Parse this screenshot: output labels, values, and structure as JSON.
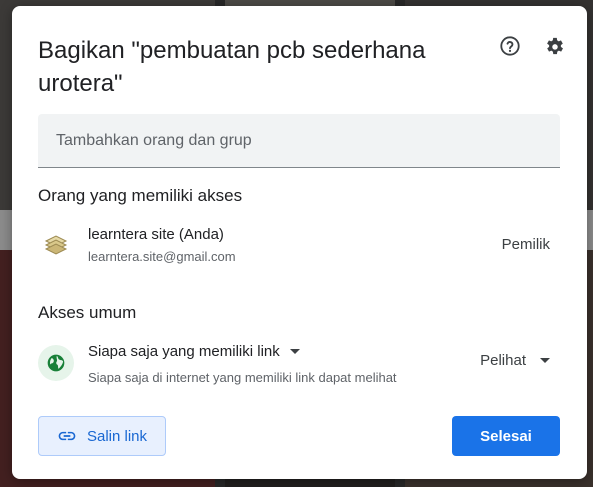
{
  "dialog": {
    "title": "Bagikan \"pembuatan pcb sederhana urotera\"",
    "help_icon": "help-circle-icon",
    "settings_icon": "gear-icon"
  },
  "add_people": {
    "placeholder": "Tambahkan orang dan grup",
    "value": ""
  },
  "people_access": {
    "heading": "Orang yang memiliki akses",
    "people": [
      {
        "name": "learntera site (Anda)",
        "email": "learntera.site@gmail.com",
        "role": "Pemilik",
        "avatar_icon": "book-logo-icon"
      }
    ]
  },
  "general_access": {
    "heading": "Akses umum",
    "icon": "globe-icon",
    "selected": "Siapa saja yang memiliki link",
    "description": "Siapa saja di internet yang memiliki link dapat melihat",
    "role": "Pelihat"
  },
  "footer": {
    "copy_link_label": "Salin link",
    "done_label": "Selesai"
  },
  "colors": {
    "primary": "#1a73e8",
    "copy_link_bg": "#e8f0fe",
    "globe_green": "#188038"
  }
}
